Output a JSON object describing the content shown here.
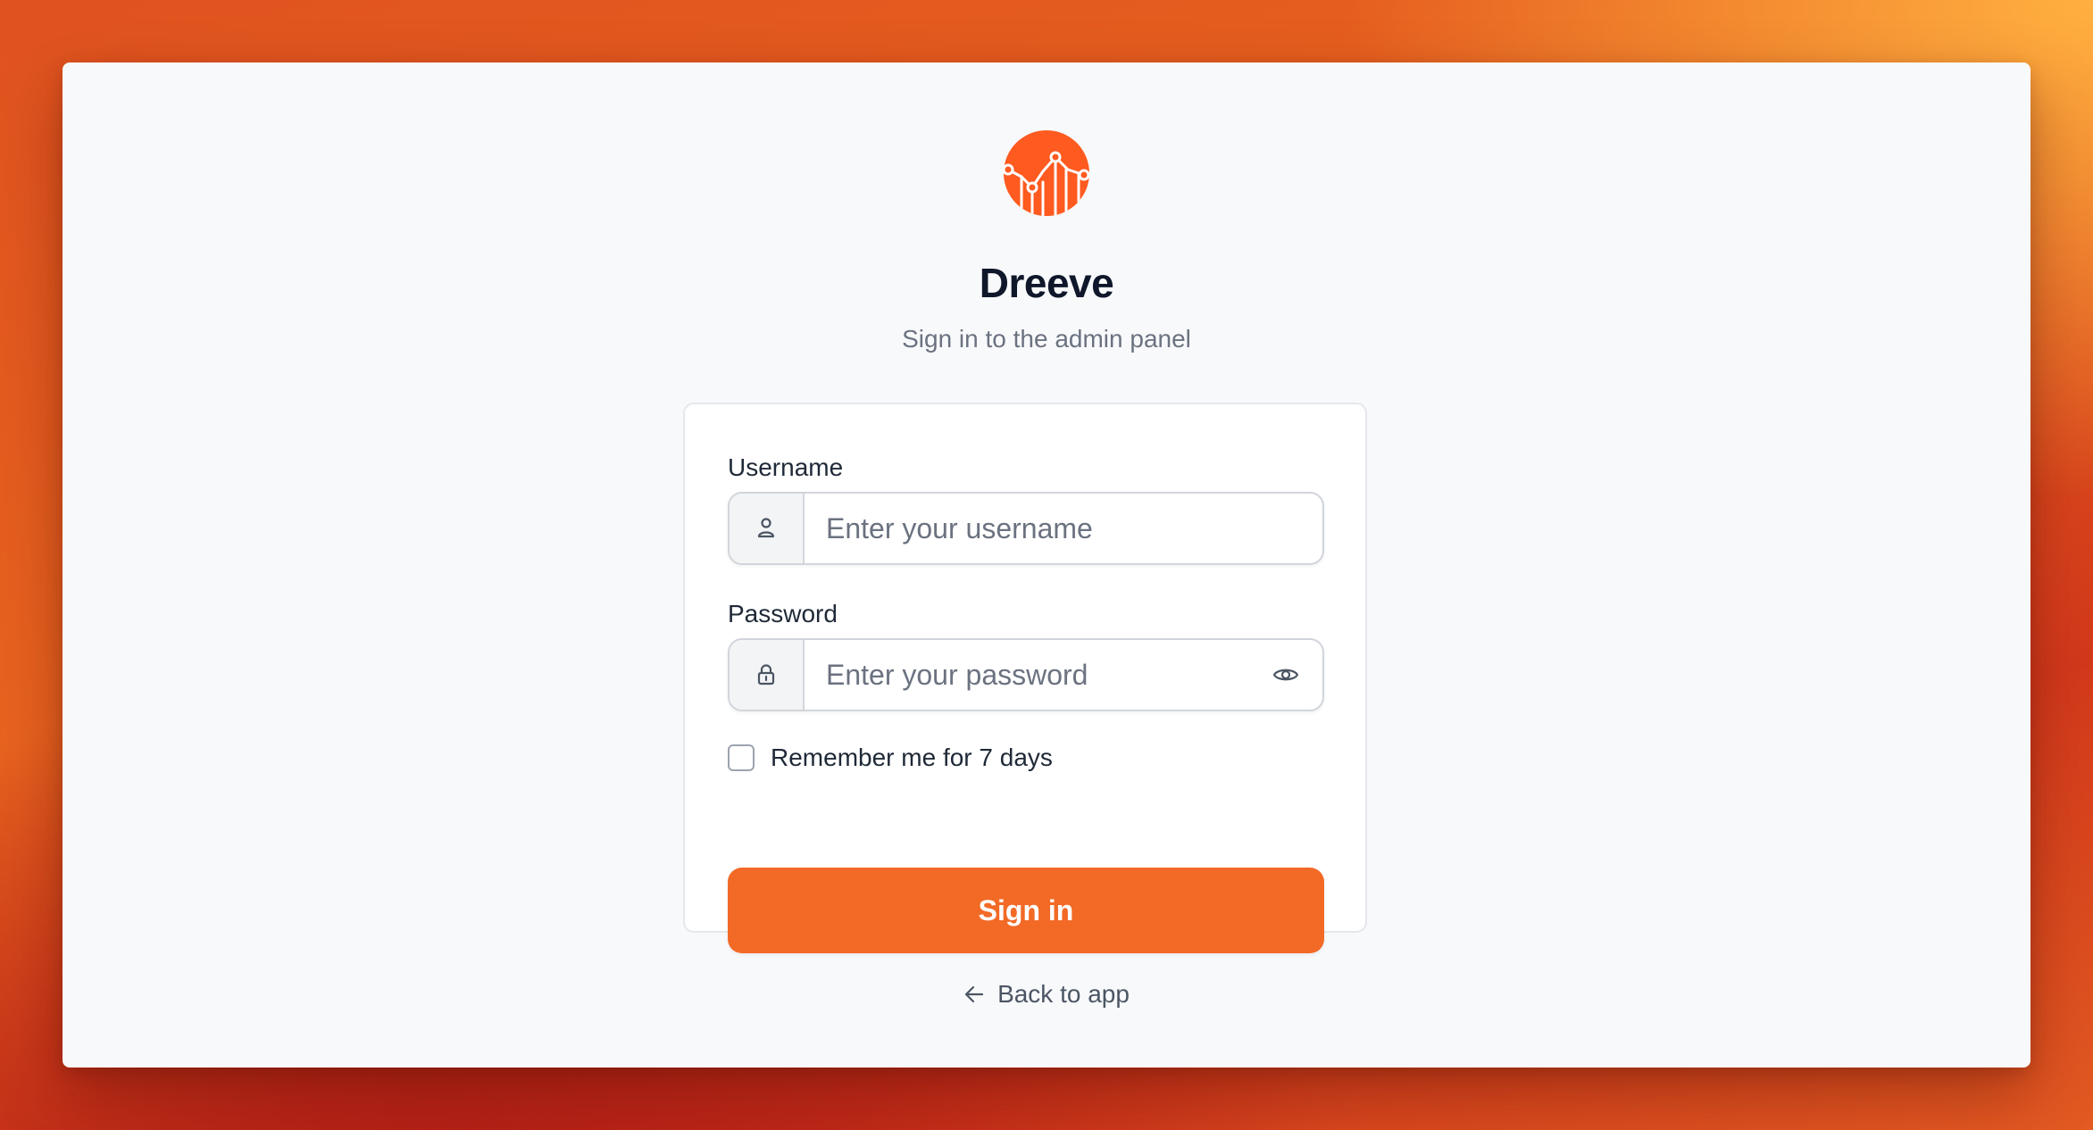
{
  "app": {
    "name": "Dreeve",
    "subtitle": "Sign in to the admin panel"
  },
  "form": {
    "username_label": "Username",
    "username_placeholder": "Enter your username",
    "username_value": "",
    "password_label": "Password",
    "password_placeholder": "Enter your password",
    "password_value": "",
    "remember_label": "Remember me for 7 days",
    "remember_checked": false,
    "submit_label": "Sign in"
  },
  "footer": {
    "back_label": "Back to app"
  },
  "colors": {
    "accent": "#f26a26",
    "logo": "#ff5a1f",
    "title": "#0f172a",
    "muted": "#6b7280"
  },
  "icons": {
    "logo": "chart-logo-icon",
    "username": "user-icon",
    "password": "lock-icon",
    "toggle": "eye-icon",
    "back": "arrow-left-icon"
  }
}
